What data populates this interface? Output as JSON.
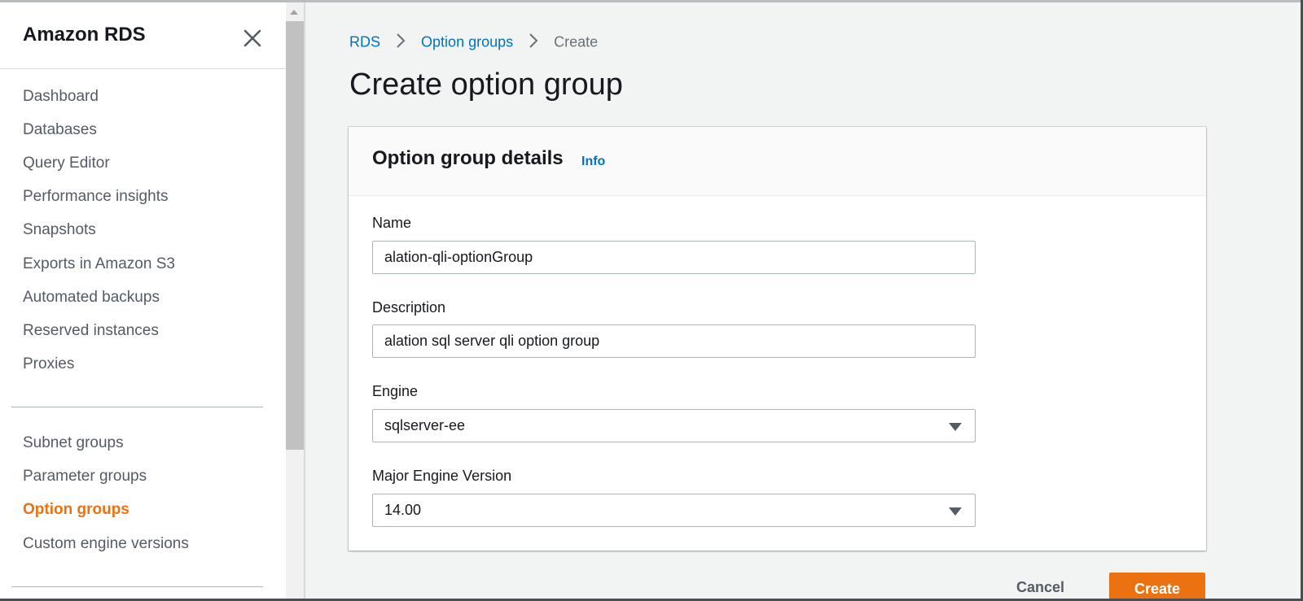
{
  "sidebar": {
    "title": "Amazon RDS",
    "items": [
      {
        "label": "Dashboard"
      },
      {
        "label": "Databases"
      },
      {
        "label": "Query Editor"
      },
      {
        "label": "Performance insights"
      },
      {
        "label": "Snapshots"
      },
      {
        "label": "Exports in Amazon S3"
      },
      {
        "label": "Automated backups"
      },
      {
        "label": "Reserved instances"
      },
      {
        "label": "Proxies"
      }
    ],
    "items2": [
      {
        "label": "Subnet groups"
      },
      {
        "label": "Parameter groups"
      },
      {
        "label": "Option groups"
      },
      {
        "label": "Custom engine versions"
      }
    ],
    "active_item": "Option groups"
  },
  "breadcrumb": {
    "items": [
      "RDS",
      "Option groups"
    ],
    "current": "Create"
  },
  "page": {
    "title": "Create option group"
  },
  "card": {
    "title": "Option group details",
    "info": "Info"
  },
  "form": {
    "name": {
      "label": "Name",
      "value": "alation-qli-optionGroup"
    },
    "description": {
      "label": "Description",
      "value": "alation sql server qli option group"
    },
    "engine": {
      "label": "Engine",
      "value": "sqlserver-ee"
    },
    "major_engine_version": {
      "label": "Major Engine Version",
      "value": "14.00"
    }
  },
  "actions": {
    "cancel": "Cancel",
    "create": "Create"
  },
  "colors": {
    "accent": "#ec7211",
    "link": "#0073bb",
    "text": "#16191f",
    "muted": "#545b64"
  }
}
